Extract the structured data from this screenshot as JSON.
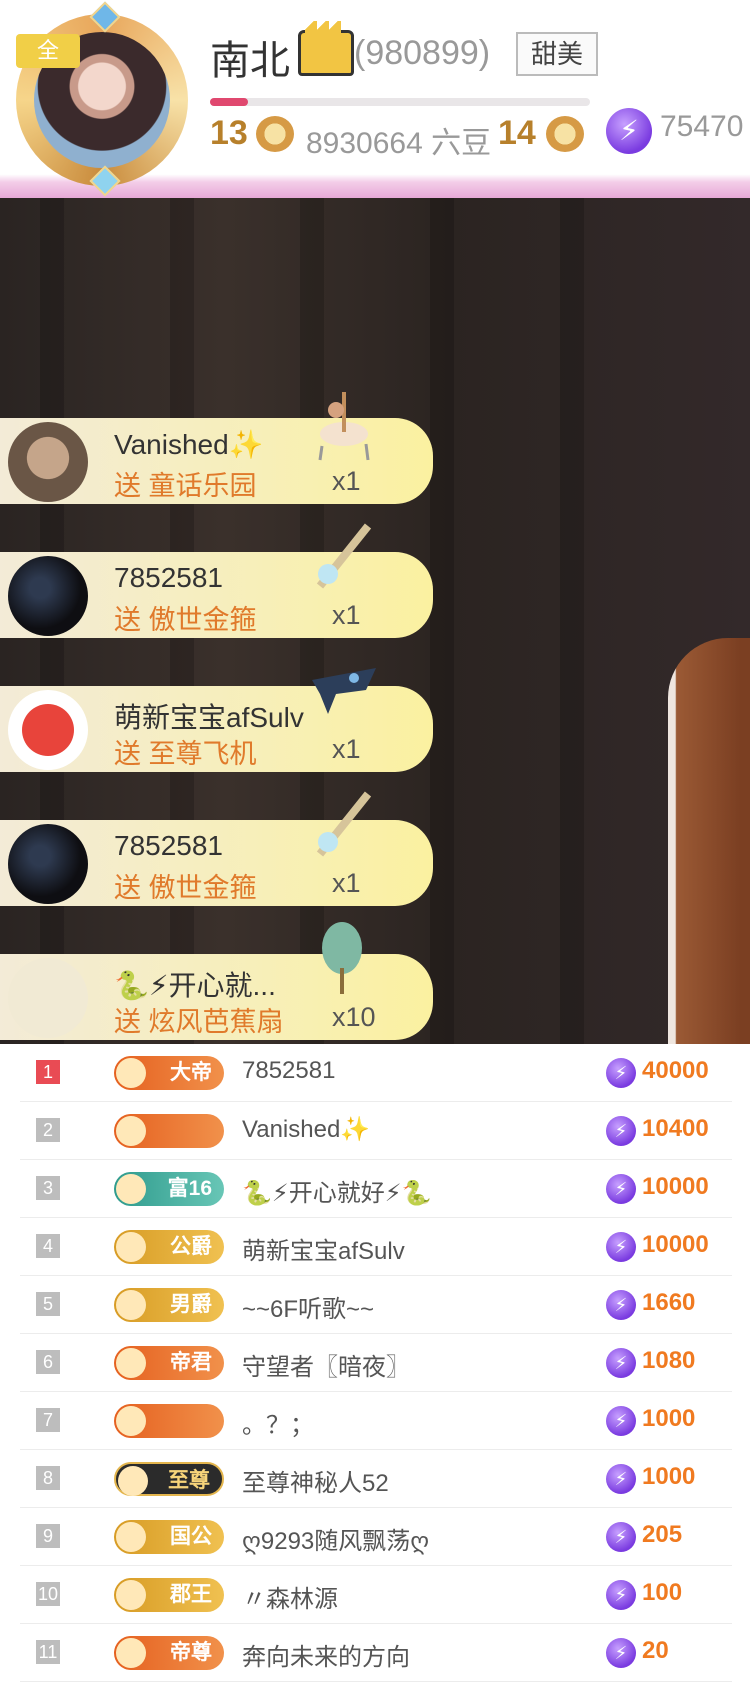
{
  "header": {
    "all_badge": "全",
    "host_name": "南北",
    "host_id": "(980899)",
    "style_tag": "甜美",
    "level_progress": 0.1,
    "level_current": "13",
    "beans": "8930664 六豆",
    "level_next": "14",
    "power_count": "75470"
  },
  "gifts": [
    {
      "user": "Vanished✨",
      "action": "送 童话乐园",
      "count": "x1"
    },
    {
      "user": "7852581",
      "action": "送 傲世金箍",
      "count": "x1"
    },
    {
      "user": "萌新宝宝afSulv",
      "action": "送 至尊飞机",
      "count": "x1"
    },
    {
      "user": "7852581",
      "action": "送 傲世金箍",
      "count": "x1"
    },
    {
      "user": "🐍⚡开心就...",
      "action": "送 炫风芭蕉扇",
      "count": "x10"
    }
  ],
  "ranking": [
    {
      "rank": "1",
      "badge": "大帝",
      "name": "7852581",
      "value": "40000"
    },
    {
      "rank": "2",
      "badge": "",
      "name": "Vanished✨",
      "value": "10400"
    },
    {
      "rank": "3",
      "badge": "富16",
      "name": "🐍⚡开心就好⚡🐍",
      "value": "10000"
    },
    {
      "rank": "4",
      "badge": "公爵",
      "name": "萌新宝宝afSulv",
      "value": "10000"
    },
    {
      "rank": "5",
      "badge": "男爵",
      "name": "~~6F听歌~~",
      "value": "1660"
    },
    {
      "rank": "6",
      "badge": "帝君",
      "name": "守望者〖暗夜〗",
      "value": "1080"
    },
    {
      "rank": "7",
      "badge": "",
      "name": "。？；",
      "value": "1000"
    },
    {
      "rank": "8",
      "badge": "至尊",
      "name": "至尊神秘人52",
      "value": "1000"
    },
    {
      "rank": "9",
      "badge": "国公",
      "name": "ღ9293随风飘荡ღ",
      "value": "205"
    },
    {
      "rank": "10",
      "badge": "郡王",
      "name": "〃森林源",
      "value": "100"
    },
    {
      "rank": "11",
      "badge": "帝尊",
      "name": "奔向未来的方向",
      "value": "20"
    }
  ],
  "colors": {
    "accent": "#f07a20",
    "rank_top": "#e94b54",
    "power": "#7a3be0"
  }
}
